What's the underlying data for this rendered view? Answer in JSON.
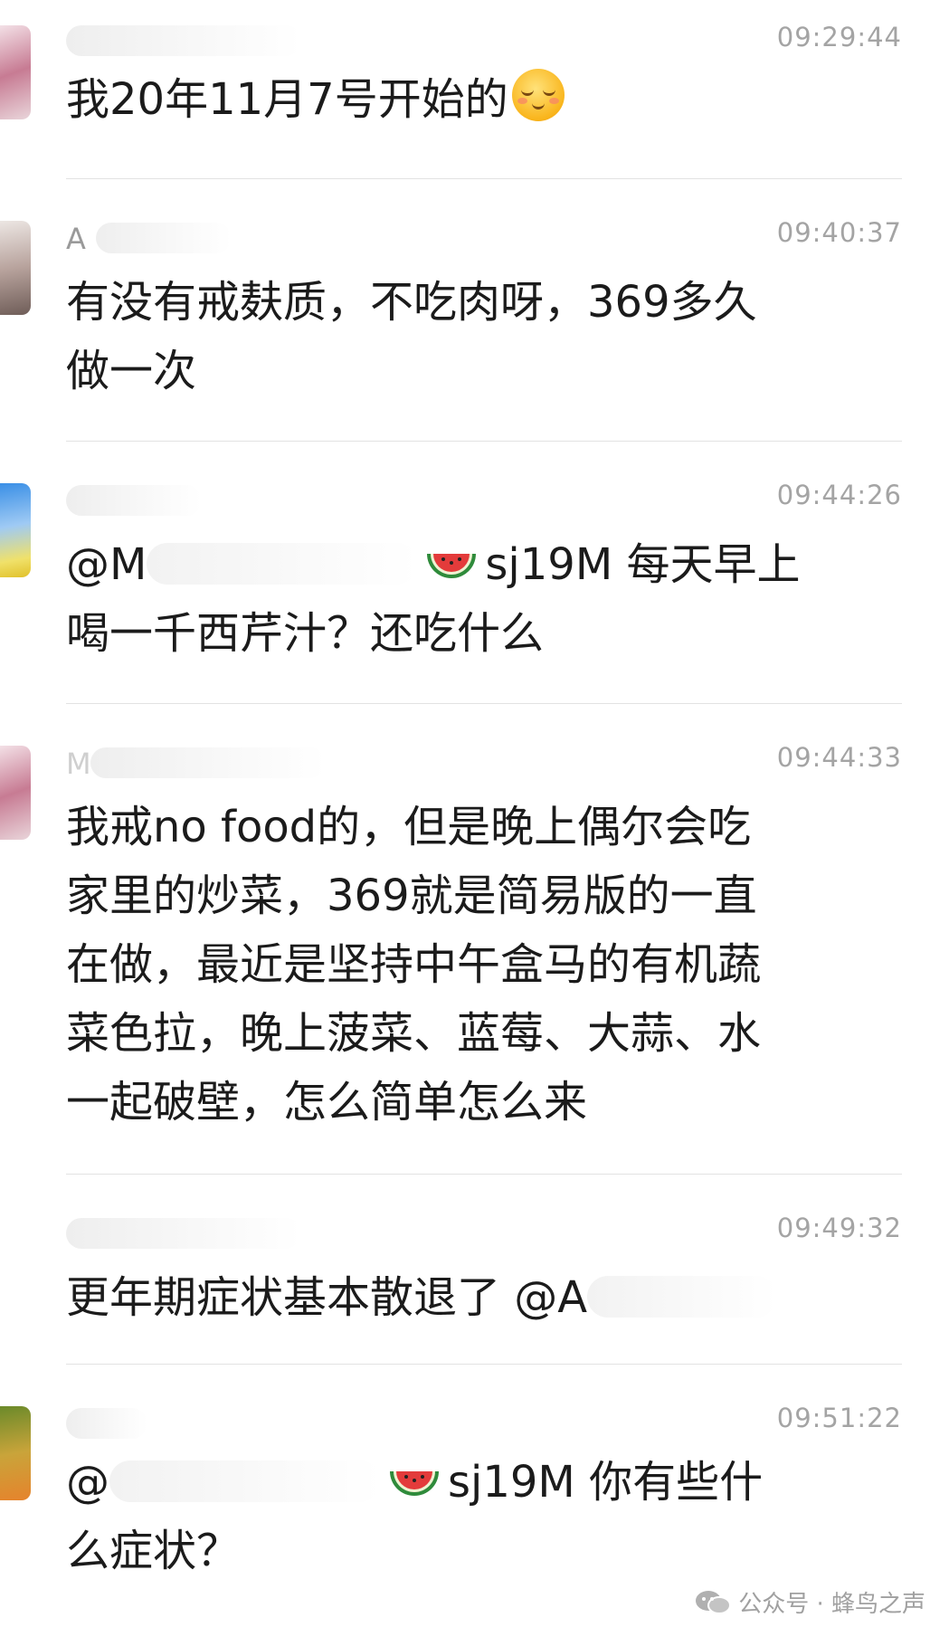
{
  "messages": [
    {
      "name": "",
      "time": "09:29:44",
      "text": "我20年11月7号开始的"
    },
    {
      "name": "A",
      "time": "09:40:37",
      "text": "有没有戒麸质，不吃肉呀，369多久\n做一次"
    },
    {
      "name": "",
      "time": "09:44:26",
      "mention": "@M",
      "text_after": "sj19M 每天早上\n喝一千西芹汁？还吃什么"
    },
    {
      "name": "M",
      "time": "09:44:33",
      "text": "我戒no food的，但是晚上偶尔会吃\n家里的炒菜，369就是简易版的一直\n在做，最近是坚持中午盒马的有机蔬\n菜色拉，晚上菠菜、蓝莓、大蒜、水\n一起破壁，怎么简单怎么来"
    },
    {
      "name": "",
      "time": "09:49:32",
      "text": "更年期症状基本散退了 @A"
    },
    {
      "name": "",
      "time": "09:51:22",
      "mention": "@",
      "text_after": "sj19M 你有些什\n么症状？"
    }
  ],
  "emoji_names": [
    "smiling-face-emoji",
    "watermelon-emoji",
    "wechat-icon"
  ],
  "watermark": {
    "text": "公众号 · 蜂鸟之声"
  }
}
